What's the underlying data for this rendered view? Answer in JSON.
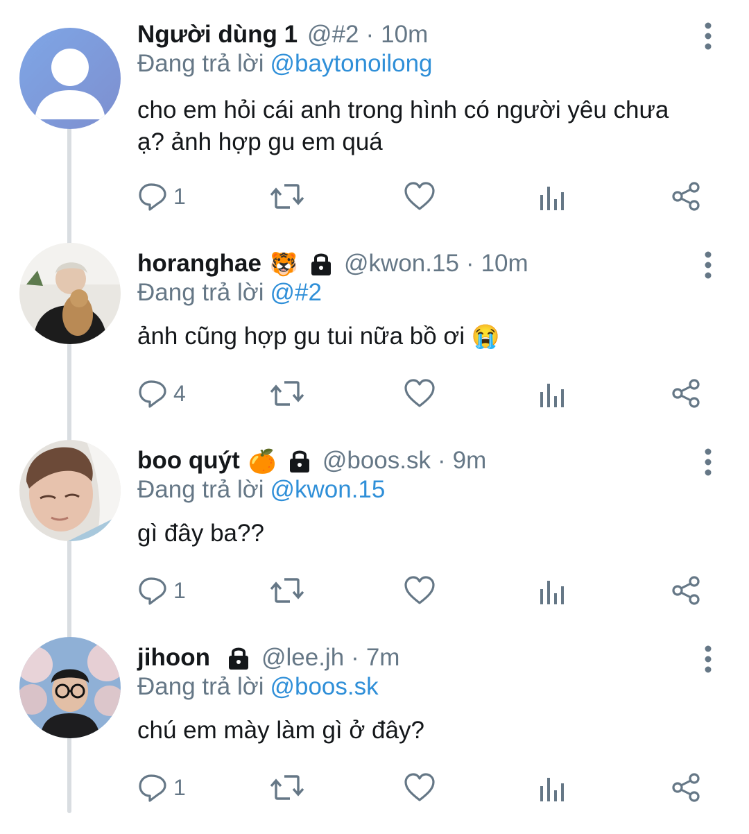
{
  "colors": {
    "accent": "#2f8fd8",
    "muted": "#657786",
    "text": "#14171a",
    "line": "#d9dde1"
  },
  "reply_prefix": "Đang trả lời",
  "tweets": [
    {
      "name": "Người dùng 1",
      "emoji": "",
      "locked": false,
      "handle": "@#2",
      "time": "10m",
      "reply_to": "@baytonoilong",
      "text": "cho em hỏi cái anh trong hình có người yêu chưa ạ? ảnh hợp gu em quá",
      "text_emoji": "",
      "avatar": "default-avatar",
      "reply_count": "1"
    },
    {
      "name": "horanghae",
      "emoji": "🐯",
      "locked": true,
      "handle": "@kwon.15",
      "time": "10m",
      "reply_to": "@#2",
      "text": "ảnh cũng hợp gu tui nữa bồ ơi",
      "text_emoji": "😭",
      "avatar": "photo-avatar-dog",
      "reply_count": "4"
    },
    {
      "name": "boo quýt",
      "emoji": "🍊",
      "locked": true,
      "handle": "@boos.sk",
      "time": "9m",
      "reply_to": "@kwon.15",
      "text": "gì đây ba??",
      "text_emoji": "",
      "avatar": "photo-avatar-face",
      "reply_count": "1"
    },
    {
      "name": "jihoon",
      "emoji": "",
      "locked": true,
      "handle": "@lee.jh",
      "time": "7m",
      "reply_to": "@boos.sk",
      "text": "chú em mày làm gì ở đây?",
      "text_emoji": "",
      "avatar": "photo-avatar-glasses",
      "reply_count": "1"
    }
  ],
  "action_icons": [
    "reply-icon",
    "retweet-icon",
    "like-icon",
    "analytics-icon",
    "share-icon"
  ]
}
